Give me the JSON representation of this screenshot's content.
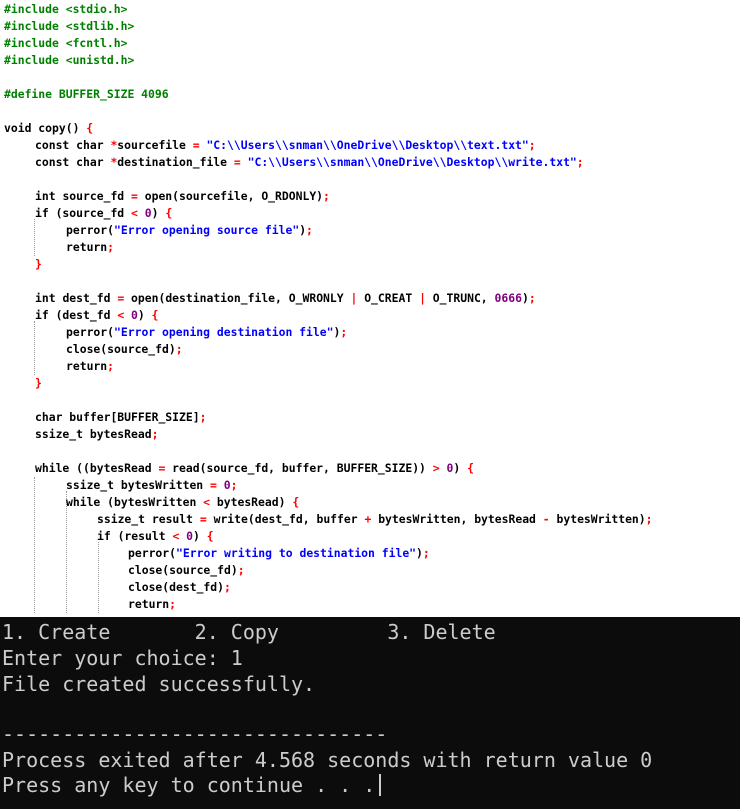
{
  "editor": {
    "lines": [
      {
        "row": 0,
        "indent": 0,
        "tokens": [
          {
            "c": "pp",
            "t": "#include <stdio.h>"
          }
        ]
      },
      {
        "row": 1,
        "indent": 0,
        "tokens": [
          {
            "c": "pp",
            "t": "#include <stdlib.h>"
          }
        ]
      },
      {
        "row": 2,
        "indent": 0,
        "tokens": [
          {
            "c": "pp",
            "t": "#include <fcntl.h>"
          }
        ]
      },
      {
        "row": 3,
        "indent": 0,
        "tokens": [
          {
            "c": "pp",
            "t": "#include <unistd.h>"
          }
        ]
      },
      {
        "row": 5,
        "indent": 0,
        "tokens": [
          {
            "c": "pp",
            "t": "#define BUFFER_SIZE 4096"
          }
        ]
      },
      {
        "row": 7,
        "indent": 0,
        "tokens": [
          {
            "c": "kw",
            "t": "void copy() "
          },
          {
            "c": "op",
            "t": "{"
          }
        ]
      },
      {
        "row": 8,
        "indent": 1,
        "tokens": [
          {
            "c": "kw",
            "t": "const char "
          },
          {
            "c": "op",
            "t": "*"
          },
          {
            "c": "fn",
            "t": "sourcefile "
          },
          {
            "c": "op",
            "t": "= "
          },
          {
            "c": "str",
            "t": "\"C:\\\\Users\\\\snman\\\\OneDrive\\\\Desktop\\\\text.txt\""
          },
          {
            "c": "op",
            "t": ";"
          }
        ]
      },
      {
        "row": 9,
        "indent": 1,
        "tokens": [
          {
            "c": "kw",
            "t": "const char "
          },
          {
            "c": "op",
            "t": "*"
          },
          {
            "c": "fn",
            "t": "destination_file "
          },
          {
            "c": "op",
            "t": "= "
          },
          {
            "c": "str",
            "t": "\"C:\\\\Users\\\\snman\\\\OneDrive\\\\Desktop\\\\write.txt\""
          },
          {
            "c": "op",
            "t": ";"
          }
        ]
      },
      {
        "row": 11,
        "indent": 1,
        "tokens": [
          {
            "c": "kw",
            "t": "int "
          },
          {
            "c": "fn",
            "t": "source_fd "
          },
          {
            "c": "op",
            "t": "= "
          },
          {
            "c": "fn",
            "t": "open(sourcefile, O_RDONLY)"
          },
          {
            "c": "op",
            "t": ";"
          }
        ]
      },
      {
        "row": 12,
        "indent": 1,
        "tokens": [
          {
            "c": "kw",
            "t": "if "
          },
          {
            "c": "fn",
            "t": "(source_fd "
          },
          {
            "c": "op",
            "t": "< "
          },
          {
            "c": "num",
            "t": "0"
          },
          {
            "c": "fn",
            "t": ") "
          },
          {
            "c": "op",
            "t": "{"
          }
        ]
      },
      {
        "row": 13,
        "indent": 2,
        "tokens": [
          {
            "c": "fn",
            "t": "perror("
          },
          {
            "c": "str",
            "t": "\"Error opening source file\""
          },
          {
            "c": "fn",
            "t": ")"
          },
          {
            "c": "op",
            "t": ";"
          }
        ]
      },
      {
        "row": 14,
        "indent": 2,
        "tokens": [
          {
            "c": "kw",
            "t": "return"
          },
          {
            "c": "op",
            "t": ";"
          }
        ]
      },
      {
        "row": 15,
        "indent": 1,
        "tokens": [
          {
            "c": "op",
            "t": "}"
          }
        ]
      },
      {
        "row": 17,
        "indent": 1,
        "tokens": [
          {
            "c": "kw",
            "t": "int "
          },
          {
            "c": "fn",
            "t": "dest_fd "
          },
          {
            "c": "op",
            "t": "= "
          },
          {
            "c": "fn",
            "t": "open(destination_file, O_WRONLY "
          },
          {
            "c": "op",
            "t": "| "
          },
          {
            "c": "fn",
            "t": "O_CREAT "
          },
          {
            "c": "op",
            "t": "| "
          },
          {
            "c": "fn",
            "t": "O_TRUNC, "
          },
          {
            "c": "num",
            "t": "0666"
          },
          {
            "c": "fn",
            "t": ")"
          },
          {
            "c": "op",
            "t": ";"
          }
        ]
      },
      {
        "row": 18,
        "indent": 1,
        "tokens": [
          {
            "c": "kw",
            "t": "if "
          },
          {
            "c": "fn",
            "t": "(dest_fd "
          },
          {
            "c": "op",
            "t": "< "
          },
          {
            "c": "num",
            "t": "0"
          },
          {
            "c": "fn",
            "t": ") "
          },
          {
            "c": "op",
            "t": "{"
          }
        ]
      },
      {
        "row": 19,
        "indent": 2,
        "tokens": [
          {
            "c": "fn",
            "t": "perror("
          },
          {
            "c": "str",
            "t": "\"Error opening destination file\""
          },
          {
            "c": "fn",
            "t": ")"
          },
          {
            "c": "op",
            "t": ";"
          }
        ]
      },
      {
        "row": 20,
        "indent": 2,
        "tokens": [
          {
            "c": "fn",
            "t": "close(source_fd)"
          },
          {
            "c": "op",
            "t": ";"
          }
        ]
      },
      {
        "row": 21,
        "indent": 2,
        "tokens": [
          {
            "c": "kw",
            "t": "return"
          },
          {
            "c": "op",
            "t": ";"
          }
        ]
      },
      {
        "row": 22,
        "indent": 1,
        "tokens": [
          {
            "c": "op",
            "t": "}"
          }
        ]
      },
      {
        "row": 24,
        "indent": 1,
        "tokens": [
          {
            "c": "kw",
            "t": "char "
          },
          {
            "c": "fn",
            "t": "buffer[BUFFER_SIZE]"
          },
          {
            "c": "op",
            "t": ";"
          }
        ]
      },
      {
        "row": 25,
        "indent": 1,
        "tokens": [
          {
            "c": "fn",
            "t": "ssize_t bytesRead"
          },
          {
            "c": "op",
            "t": ";"
          }
        ]
      },
      {
        "row": 27,
        "indent": 1,
        "tokens": [
          {
            "c": "kw",
            "t": "while "
          },
          {
            "c": "fn",
            "t": "((bytesRead "
          },
          {
            "c": "op",
            "t": "= "
          },
          {
            "c": "fn",
            "t": "read(source_fd, buffer, BUFFER_SIZE)) "
          },
          {
            "c": "op",
            "t": "> "
          },
          {
            "c": "num",
            "t": "0"
          },
          {
            "c": "fn",
            "t": ") "
          },
          {
            "c": "op",
            "t": "{"
          }
        ]
      },
      {
        "row": 28,
        "indent": 2,
        "tokens": [
          {
            "c": "fn",
            "t": "ssize_t bytesWritten "
          },
          {
            "c": "op",
            "t": "= "
          },
          {
            "c": "num",
            "t": "0"
          },
          {
            "c": "op",
            "t": ";"
          }
        ]
      },
      {
        "row": 29,
        "indent": 2,
        "tokens": [
          {
            "c": "kw",
            "t": "while "
          },
          {
            "c": "fn",
            "t": "(bytesWritten "
          },
          {
            "c": "op",
            "t": "< "
          },
          {
            "c": "fn",
            "t": "bytesRead) "
          },
          {
            "c": "op",
            "t": "{"
          }
        ]
      },
      {
        "row": 30,
        "indent": 3,
        "tokens": [
          {
            "c": "fn",
            "t": "ssize_t result "
          },
          {
            "c": "op",
            "t": "= "
          },
          {
            "c": "fn",
            "t": "write(dest_fd, buffer "
          },
          {
            "c": "op",
            "t": "+ "
          },
          {
            "c": "fn",
            "t": "bytesWritten, bytesRead "
          },
          {
            "c": "op",
            "t": "- "
          },
          {
            "c": "fn",
            "t": "bytesWritten)"
          },
          {
            "c": "op",
            "t": ";"
          }
        ]
      },
      {
        "row": 31,
        "indent": 3,
        "tokens": [
          {
            "c": "kw",
            "t": "if "
          },
          {
            "c": "fn",
            "t": "(result "
          },
          {
            "c": "op",
            "t": "< "
          },
          {
            "c": "num",
            "t": "0"
          },
          {
            "c": "fn",
            "t": ") "
          },
          {
            "c": "op",
            "t": "{"
          }
        ]
      },
      {
        "row": 32,
        "indent": 4,
        "tokens": [
          {
            "c": "fn",
            "t": "perror("
          },
          {
            "c": "str",
            "t": "\"Error writing to destination file\""
          },
          {
            "c": "fn",
            "t": ")"
          },
          {
            "c": "op",
            "t": ";"
          }
        ]
      },
      {
        "row": 33,
        "indent": 4,
        "tokens": [
          {
            "c": "fn",
            "t": "close(source_fd)"
          },
          {
            "c": "op",
            "t": ";"
          }
        ]
      },
      {
        "row": 34,
        "indent": 4,
        "tokens": [
          {
            "c": "fn",
            "t": "close(dest_fd)"
          },
          {
            "c": "op",
            "t": ";"
          }
        ]
      },
      {
        "row": 35,
        "indent": 4,
        "tokens": [
          {
            "c": "kw",
            "t": "return"
          },
          {
            "c": "op",
            "t": ";"
          }
        ]
      }
    ]
  },
  "console": {
    "menu": "1. Create       2. Copy         3. Delete",
    "prompt": "Enter your choice: 1",
    "result": "File created successfully.",
    "separator": "--------------------------------",
    "exit_message": "Process exited after 4.568 seconds with return value 0",
    "continue_prompt": "Press any key to continue . . ."
  }
}
